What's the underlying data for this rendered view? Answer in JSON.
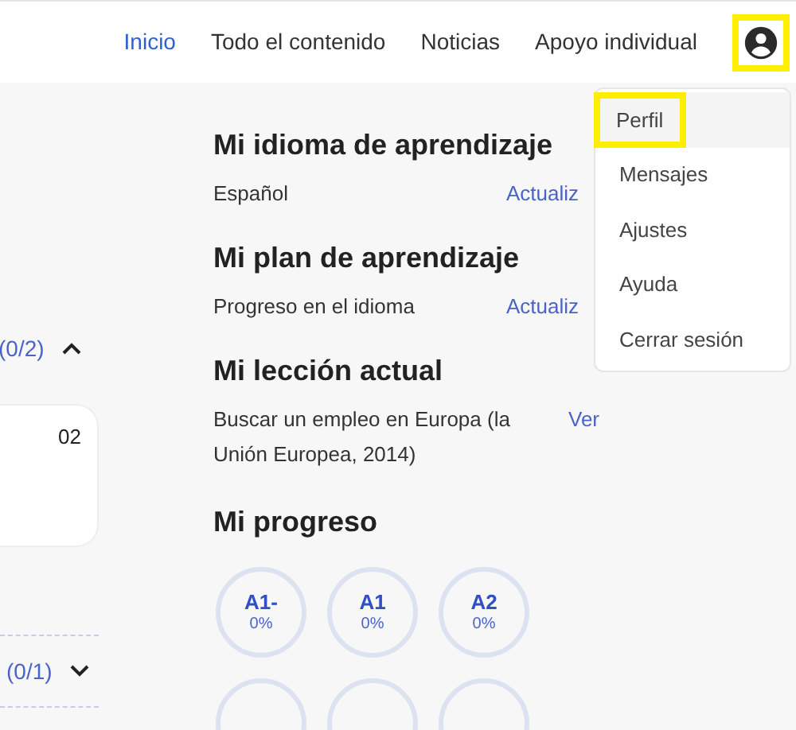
{
  "nav": {
    "items": [
      {
        "label": "Inicio",
        "selected": true
      },
      {
        "label": "Todo el contenido",
        "selected": false
      },
      {
        "label": "Noticias",
        "selected": false
      },
      {
        "label": "Apoyo individual",
        "selected": false
      }
    ],
    "avatar_highlighted": true
  },
  "user_menu": {
    "items": [
      {
        "label": "Perfil",
        "highlighted": true
      },
      {
        "label": "Mensajes",
        "highlighted": false
      },
      {
        "label": "Ajustes",
        "highlighted": false
      },
      {
        "label": "Ayuda",
        "highlighted": false
      },
      {
        "label": "Cerrar sesión",
        "highlighted": false
      }
    ]
  },
  "sidebar": {
    "sections": [
      {
        "count": "(0/2)",
        "expanded": true,
        "card_text": "02"
      },
      {
        "count": "(0/1)",
        "expanded": false
      }
    ]
  },
  "sections": [
    {
      "title": "Mi idioma de aprendizaje",
      "text": "Español",
      "link": "Actualiz"
    },
    {
      "title": "Mi plan de aprendizaje",
      "text": "Progreso en el idioma",
      "link": "Actualiz"
    },
    {
      "title": "Mi lección actual",
      "text": "Buscar un empleo en Europa (la Unión Europea, 2014)",
      "link": "Ver"
    }
  ],
  "progress": {
    "title": "Mi progreso",
    "levels": [
      {
        "label": "A1-",
        "percent": "0%"
      },
      {
        "label": "A1",
        "percent": "0%"
      },
      {
        "label": "A2",
        "percent": "0%"
      }
    ]
  }
}
